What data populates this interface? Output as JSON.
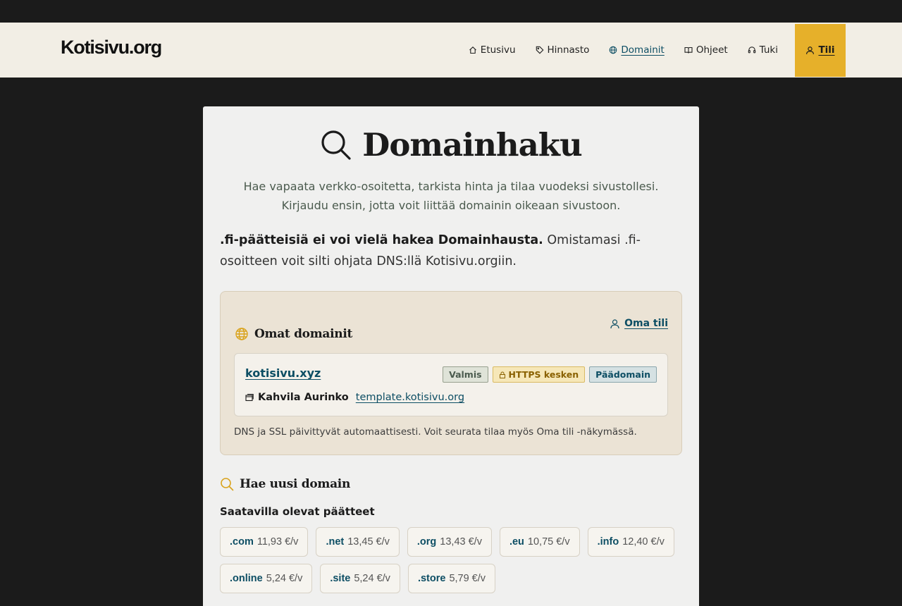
{
  "header": {
    "logo": "Kotisivu.org",
    "nav": [
      {
        "id": "home",
        "label": "Etusivu",
        "icon": "home-icon"
      },
      {
        "id": "pricing",
        "label": "Hinnasto",
        "icon": "tag-icon"
      },
      {
        "id": "domains",
        "label": "Domainit",
        "icon": "globe-icon",
        "active": true
      },
      {
        "id": "guides",
        "label": "Ohjeet",
        "icon": "book-icon"
      },
      {
        "id": "support",
        "label": "Tuki",
        "icon": "headset-icon"
      }
    ],
    "account_label": "Tili"
  },
  "page": {
    "title": "Domainhaku",
    "subtitle": "Hae vapaata verkko-osoitetta, tarkista hinta ja tilaa vuodeksi sivustollesi. Kirjaudu ensin, jotta voit liittää domainin oikeaan sivustoon.",
    "notice_bold": ".fi-päätteisiä ei voi vielä hakea Domainhausta.",
    "notice_rest": " Omistamasi .fi-osoitteen voit silti ohjata DNS:llä Kotisivu.orgiin."
  },
  "own_domains": {
    "title": "Omat domainit",
    "account_link": "Oma tili",
    "domain": {
      "name": "kotisivu.xyz",
      "badges": {
        "ready": "Valmis",
        "https": "HTTPS kesken",
        "main": "Päädomain"
      },
      "site_name": "Kahvila Aurinko",
      "site_url": "template.kotisivu.org"
    },
    "note": "DNS ja SSL päivittyvät automaattisesti. Voit seurata tilaa myös Oma tili -näkymässä."
  },
  "new_domain": {
    "title": "Hae uusi domain",
    "available_label": "Saatavilla olevat päätteet",
    "tlds": [
      {
        "ext": ".com",
        "price": "11,93 €/v"
      },
      {
        "ext": ".net",
        "price": "13,45 €/v"
      },
      {
        "ext": ".org",
        "price": "13,43 €/v"
      },
      {
        "ext": ".eu",
        "price": "10,75 €/v"
      },
      {
        "ext": ".info",
        "price": "12,40 €/v"
      },
      {
        "ext": ".online",
        "price": "5,24 €/v"
      },
      {
        "ext": ".site",
        "price": "5,24 €/v"
      },
      {
        "ext": ".store",
        "price": "5,79 €/v"
      }
    ]
  },
  "colors": {
    "accent": "#e6b02a",
    "link": "#0d4e64",
    "header_bg": "#f2eee5",
    "page_bg": "#1b1b1b"
  }
}
